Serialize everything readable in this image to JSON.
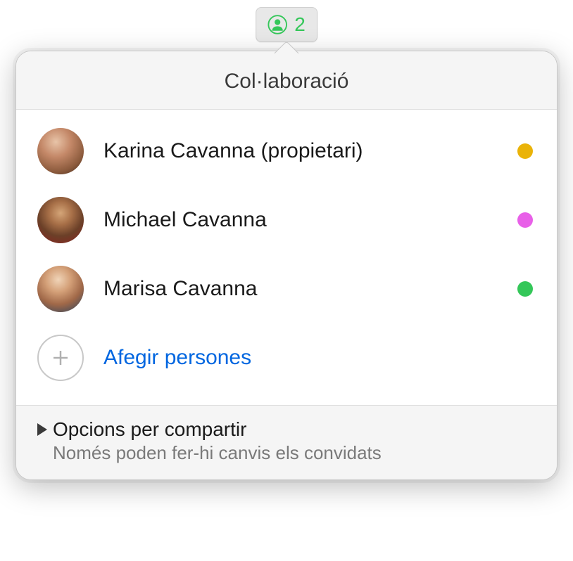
{
  "toolbar": {
    "count": "2"
  },
  "popover": {
    "title": "Col·laboració",
    "participants": [
      {
        "name": "Karina Cavanna (propietari)",
        "color": "#eab308"
      },
      {
        "name": "Michael Cavanna",
        "color": "#e860e8"
      },
      {
        "name": "Marisa Cavanna",
        "color": "#34c759"
      }
    ],
    "add_label": "Afegir persones",
    "footer": {
      "title": "Opcions per compartir",
      "subtitle": "Només poden fer-hi canvis els convidats"
    }
  }
}
